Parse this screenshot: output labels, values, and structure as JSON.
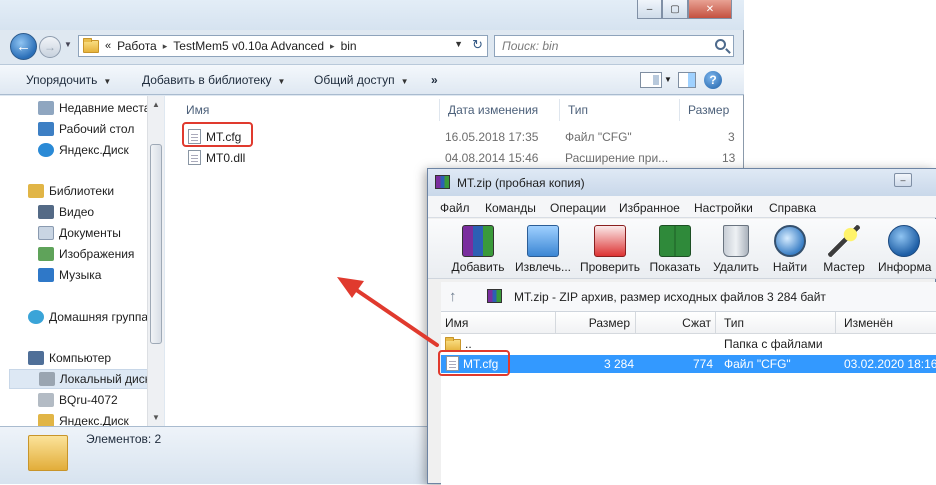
{
  "explorer": {
    "breadcrumb": [
      "Работа",
      "TestMem5 v0.10a Advanced",
      "bin"
    ],
    "breadcrumb_prefix": "«",
    "search_placeholder": "Поиск: bin",
    "toolbar": {
      "organize": "Упорядочить",
      "add_to_library": "Добавить в библиотеку",
      "share": "Общий доступ",
      "more": "»"
    },
    "nav": {
      "items": [
        {
          "label": "Недавние места",
          "icon": "recent-places-icon"
        },
        {
          "label": "Рабочий стол",
          "icon": "desktop-icon"
        },
        {
          "label": "Яндекс.Диск",
          "icon": "yandex-disk-icon"
        },
        {
          "label": "Библиотеки",
          "icon": "libraries-icon"
        },
        {
          "label": "Видео",
          "icon": "video-icon"
        },
        {
          "label": "Документы",
          "icon": "documents-icon"
        },
        {
          "label": "Изображения",
          "icon": "images-icon"
        },
        {
          "label": "Музыка",
          "icon": "music-icon"
        },
        {
          "label": "Домашняя группа",
          "icon": "homegroup-icon"
        },
        {
          "label": "Компьютер",
          "icon": "computer-icon"
        },
        {
          "label": "Локальный диск",
          "icon": "local-disk-icon"
        },
        {
          "label": "BQru-4072",
          "icon": "drive-icon"
        },
        {
          "label": "Яндекс.Диск",
          "icon": "yandex-disk-icon"
        }
      ]
    },
    "columns": {
      "name": "Имя",
      "date": "Дата изменения",
      "type": "Тип",
      "size": "Размер"
    },
    "files": [
      {
        "name": "MT.cfg",
        "date": "16.05.2018 17:35",
        "type": "Файл \"CFG\"",
        "size": "3"
      },
      {
        "name": "MT0.dll",
        "date": "04.08.2014 15:46",
        "type": "Расширение при...",
        "size": "13"
      }
    ],
    "status": "Элементов: 2"
  },
  "winrar": {
    "title": "MT.zip (пробная копия)",
    "menu": [
      "Файл",
      "Команды",
      "Операции",
      "Избранное",
      "Настройки",
      "Справка"
    ],
    "tools": [
      {
        "label": "Добавить",
        "icon": "add-archive-icon"
      },
      {
        "label": "Извлечь...",
        "icon": "extract-icon"
      },
      {
        "label": "Проверить",
        "icon": "test-icon"
      },
      {
        "label": "Показать",
        "icon": "view-icon"
      },
      {
        "label": "Удалить",
        "icon": "delete-icon"
      },
      {
        "label": "Найти",
        "icon": "find-icon"
      },
      {
        "label": "Мастер",
        "icon": "wizard-icon"
      },
      {
        "label": "Информа",
        "icon": "info-icon"
      }
    ],
    "path_text": "MT.zip - ZIP архив, размер исходных файлов 3 284 байт",
    "columns": {
      "name": "Имя",
      "size": "Размер",
      "packed": "Сжат",
      "type": "Тип",
      "modified": "Изменён"
    },
    "rows": [
      {
        "name": "..",
        "size": "",
        "packed": "",
        "type": "Папка с файлами",
        "modified": ""
      },
      {
        "name": "MT.cfg",
        "size": "3 284",
        "packed": "774",
        "type": "Файл \"CFG\"",
        "modified": "03.02.2020 18:16"
      }
    ]
  },
  "colors": {
    "highlight": "#e03a2e",
    "selection": "#3399ff"
  }
}
